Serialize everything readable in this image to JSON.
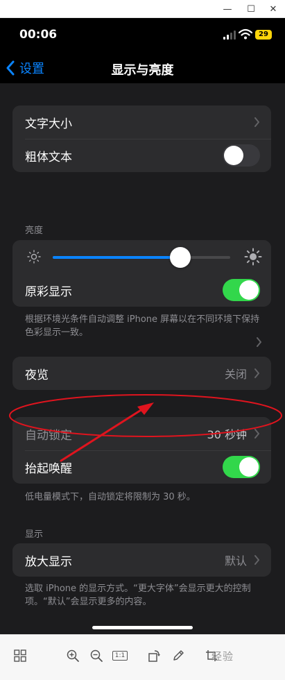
{
  "status_bar": {
    "time": "00:06",
    "battery": "29"
  },
  "nav": {
    "back_label": "设置",
    "title": "显示与亮度"
  },
  "text_group": {
    "text_size_label": "文字大小",
    "bold_text_label": "粗体文本",
    "bold_text_on": false
  },
  "brightness": {
    "header": "亮度",
    "level": 0.72,
    "true_tone_label": "原彩显示",
    "true_tone_on": true,
    "footnote": "根据环境光条件自动调整 iPhone 屏幕以在不同环境下保持色彩显示一致。"
  },
  "night_shift": {
    "label": "夜览",
    "value": "关闭"
  },
  "lock_group": {
    "auto_lock_label": "自动锁定",
    "auto_lock_value": "30 秒钟",
    "raise_to_wake_label": "抬起唤醒",
    "raise_to_wake_on": true,
    "footnote": "低电量模式下，自动锁定将限制为 30 秒。"
  },
  "display": {
    "header": "显示",
    "zoom_label": "放大显示",
    "zoom_value": "默认",
    "footnote": "选取 iPhone 的显示方式。“更大字体”会显示更大的控制项。“默认”会显示更多的内容。"
  },
  "toolbar": {
    "actual_size": "1:1",
    "watermark": "经验"
  },
  "colors": {
    "accent": "#0a84ff",
    "toggle_on": "#32d74b",
    "annotation": "#e0141e"
  }
}
